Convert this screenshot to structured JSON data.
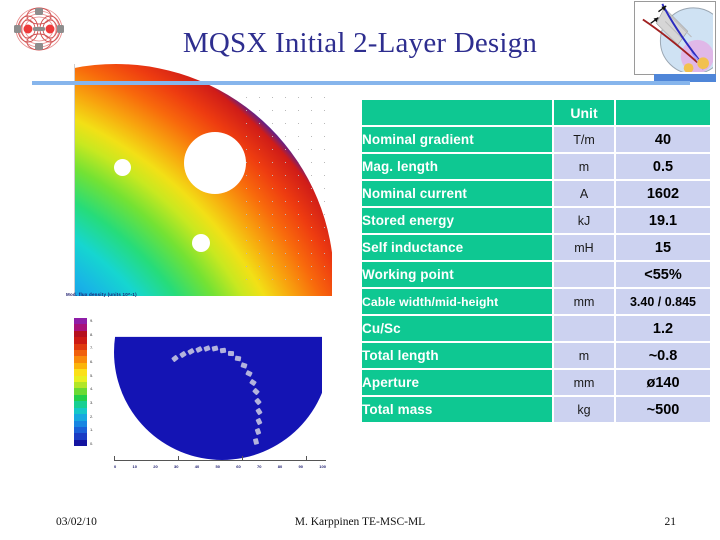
{
  "slide": {
    "title": "MQSX Initial 2-Layer Design",
    "title_color": "#2e2e8f",
    "accent_rule_color": "#86b5ec",
    "background_color": "#ffffff"
  },
  "logos": {
    "top_left": "magnetic-flux-rosette-plot",
    "top_right": "coil-end-cad-thumbnail"
  },
  "figures": {
    "top_plot": {
      "name": "fem-field-map-quarter-cross-section",
      "description": "Quarter cross-section FEM magnetic field magnitude contour map with rainbow colour scale and three circular holes"
    },
    "bottom_plot": {
      "name": "fem-field-map-aperture-quarter",
      "caption": "Mod. flux density (units 10^-1)",
      "colorbar_labels": [
        "9.",
        "8.",
        "7.",
        "6.",
        "5.",
        "4.",
        "3.",
        "2.",
        "1.",
        "0.",
        "9.",
        "8.",
        "7.",
        "6.",
        "5.",
        "4.",
        "3.",
        "2.",
        "1.",
        "0."
      ],
      "x_ticks": [
        "0",
        "10",
        "20",
        "30",
        "40",
        "50",
        "60",
        "70",
        "80",
        "90",
        "100"
      ]
    }
  },
  "table": {
    "name": "mqsx-parameter-table",
    "header": {
      "label": "",
      "unit": "Unit",
      "value": ""
    },
    "colors": {
      "label_bg": "#0ec892",
      "label_fg": "#ffffff",
      "value_bg": "#ccd2f0",
      "value_fg": "#000000"
    },
    "rows": [
      {
        "label": "Nominal gradient",
        "unit": "T/m",
        "value": "40"
      },
      {
        "label": "Mag. length",
        "unit": "m",
        "value": "0.5"
      },
      {
        "label": "Nominal current",
        "unit": "A",
        "value": "1602"
      },
      {
        "label": "Stored energy",
        "unit": "kJ",
        "value": "19.1"
      },
      {
        "label": "Self inductance",
        "unit": "mH",
        "value": "15"
      },
      {
        "label": "Working point",
        "unit": "",
        "value": "<55%"
      },
      {
        "label": "Cable width/mid-height",
        "unit": "mm",
        "value": "3.40 / 0.845"
      },
      {
        "label": "Cu/Sc",
        "unit": "",
        "value": "1.2"
      },
      {
        "label": "Total length",
        "unit": "m",
        "value": "~0.8"
      },
      {
        "label": "Aperture",
        "unit": "mm",
        "value": "ø140"
      },
      {
        "label": "Total mass",
        "unit": "kg",
        "value": "~500"
      }
    ]
  },
  "footer": {
    "date": "03/02/10",
    "author": "M. Karppinen TE-MSC-ML",
    "page_number": "21"
  }
}
